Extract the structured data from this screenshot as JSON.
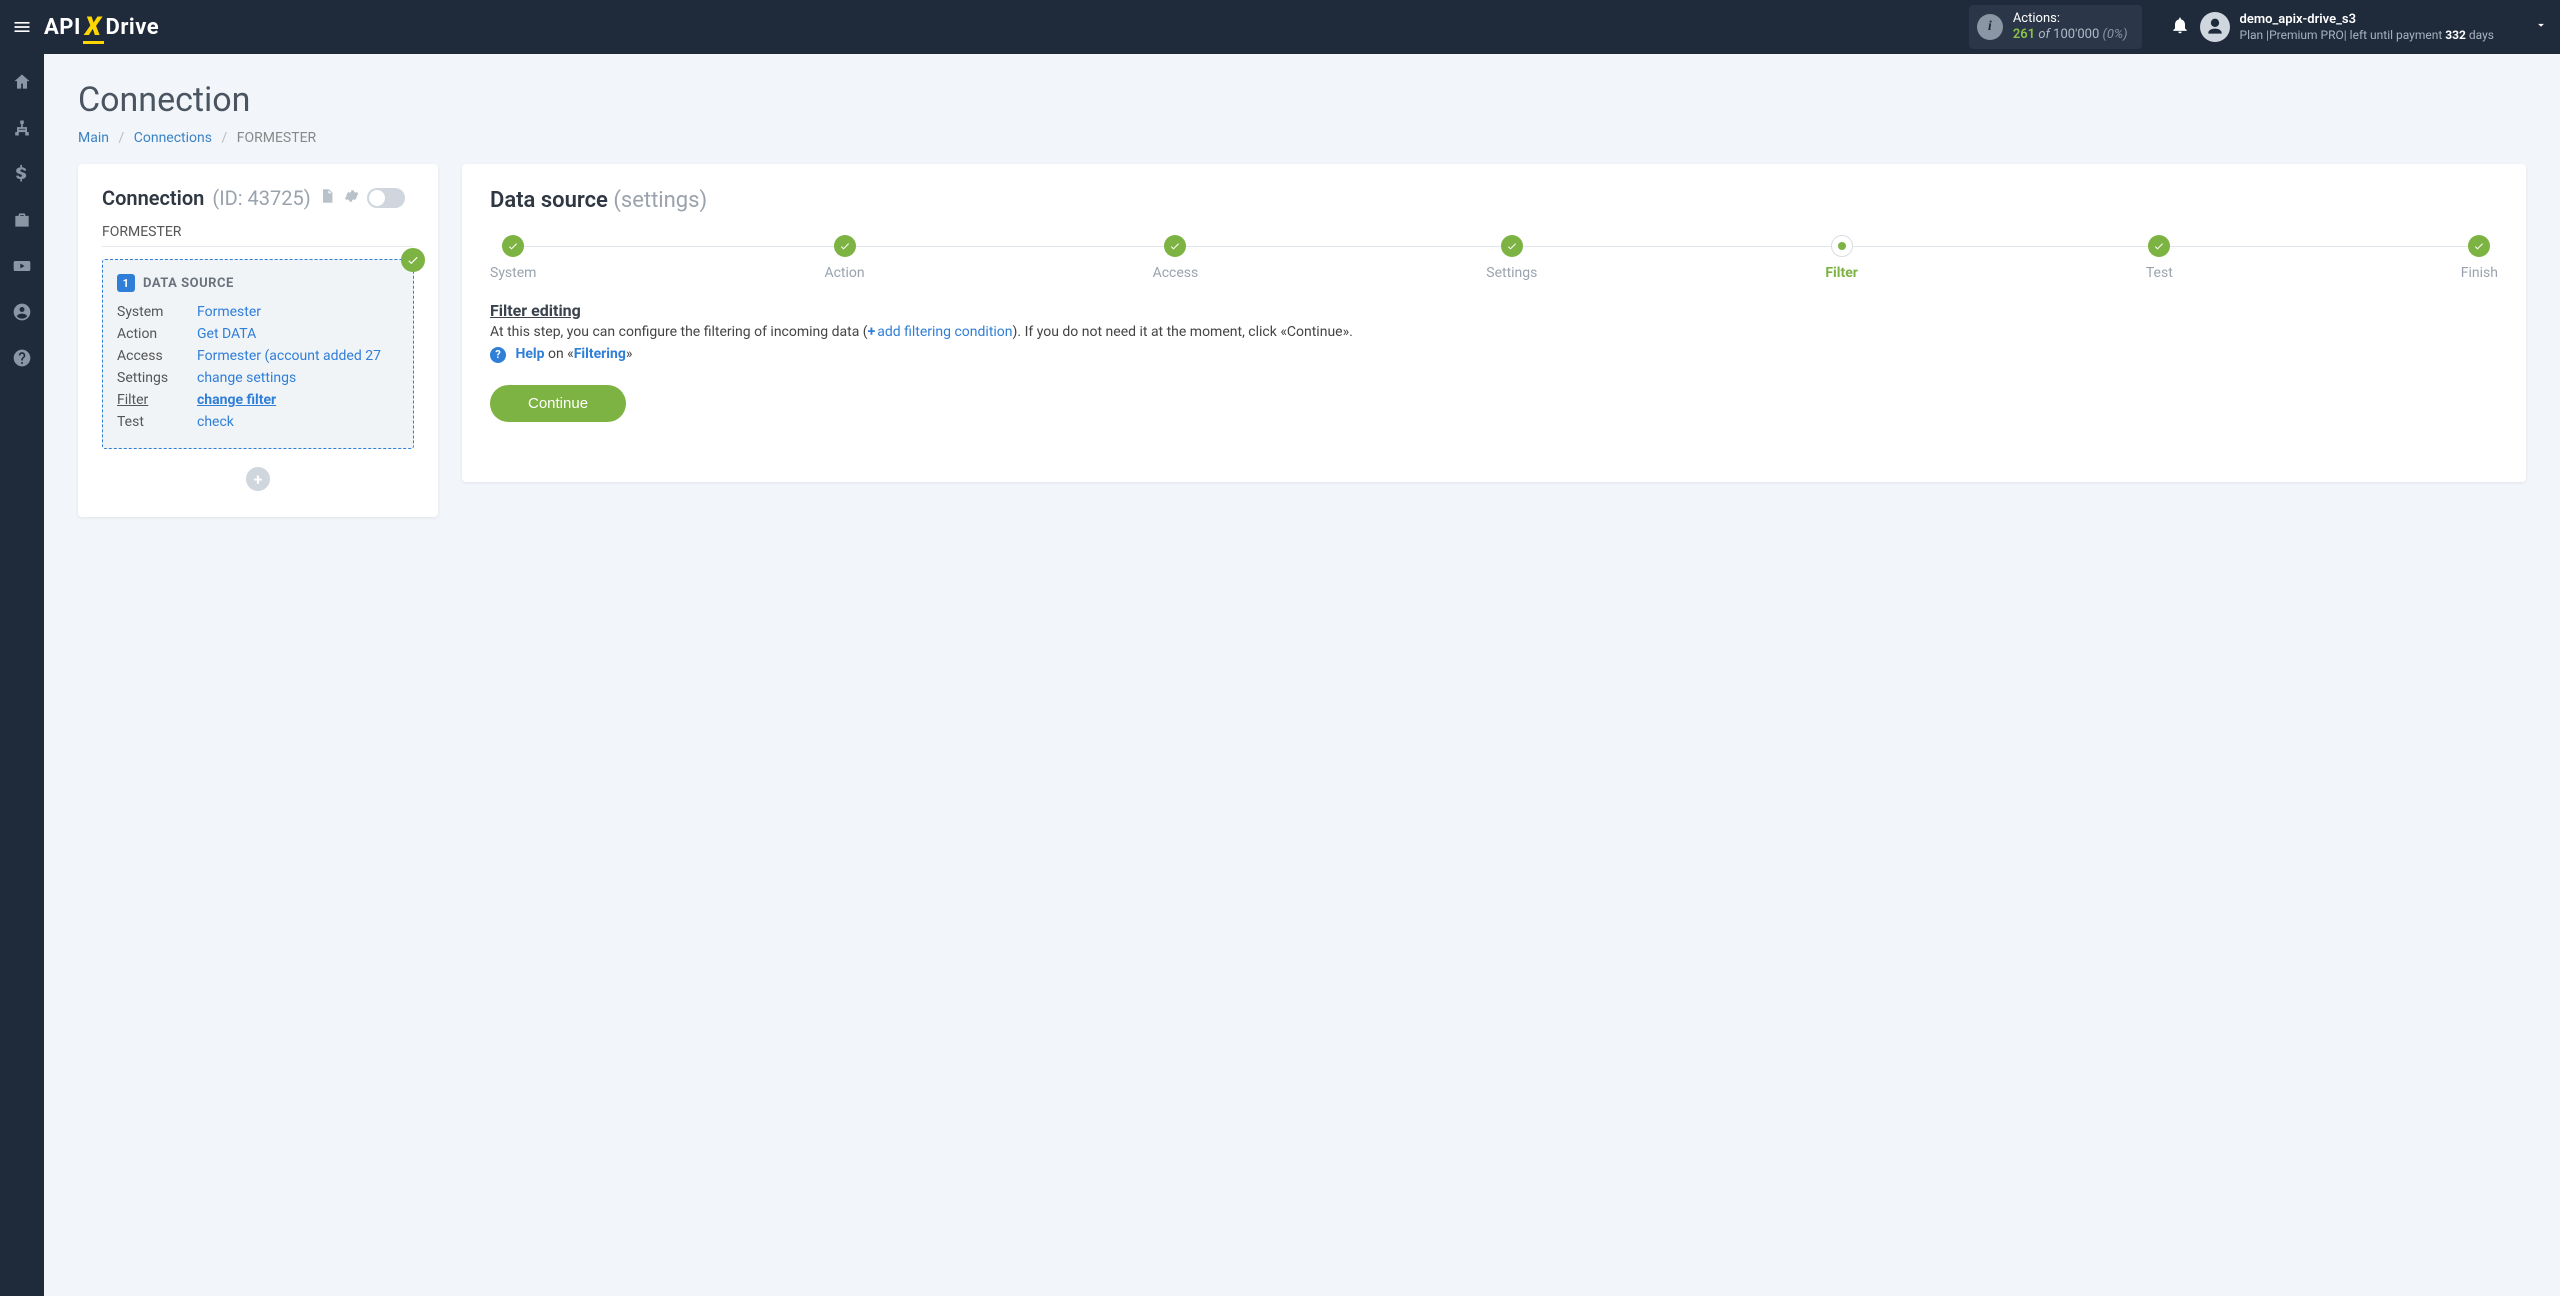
{
  "header": {
    "actions": {
      "label": "Actions:",
      "count": "261",
      "of": "of",
      "limit": "100'000",
      "percent": "(0%)"
    },
    "user": {
      "name": "demo_apix-drive_s3",
      "plan_prefix": "Plan |",
      "plan_name": "Premium PRO",
      "left_prefix": "| left until payment ",
      "days": "332",
      "days_suffix": " days"
    }
  },
  "page": {
    "title": "Connection",
    "crumbs": {
      "main": "Main",
      "connections": "Connections",
      "current": "FORMESTER"
    }
  },
  "left": {
    "title": "Connection",
    "id": "(ID: 43725)",
    "name": "FORMESTER",
    "ds": {
      "badge": "1",
      "title": "DATA SOURCE",
      "rows": [
        {
          "k": "System",
          "v": "Formester"
        },
        {
          "k": "Action",
          "v": "Get DATA"
        },
        {
          "k": "Access",
          "v": "Formester (account added 27"
        },
        {
          "k": "Settings",
          "v": "change settings"
        },
        {
          "k": "Filter",
          "v": "change filter",
          "current": true
        },
        {
          "k": "Test",
          "v": "check"
        }
      ]
    }
  },
  "right": {
    "title": "Data source",
    "subtitle": "(settings)",
    "steps": [
      {
        "label": "System",
        "state": "done"
      },
      {
        "label": "Action",
        "state": "done"
      },
      {
        "label": "Access",
        "state": "done"
      },
      {
        "label": "Settings",
        "state": "done"
      },
      {
        "label": "Filter",
        "state": "cur"
      },
      {
        "label": "Test",
        "state": "done"
      },
      {
        "label": "Finish",
        "state": "done"
      }
    ],
    "filter": {
      "heading": "Filter editing",
      "desc_a": "At this step, you can configure the filtering of incoming data (",
      "add_link": "add filtering condition",
      "desc_b": "). If you do not need it at the moment, click «Continue».",
      "help_word": "Help",
      "help_on": " on «",
      "help_topic": "Filtering",
      "help_close": "»"
    },
    "continue": "Continue"
  }
}
